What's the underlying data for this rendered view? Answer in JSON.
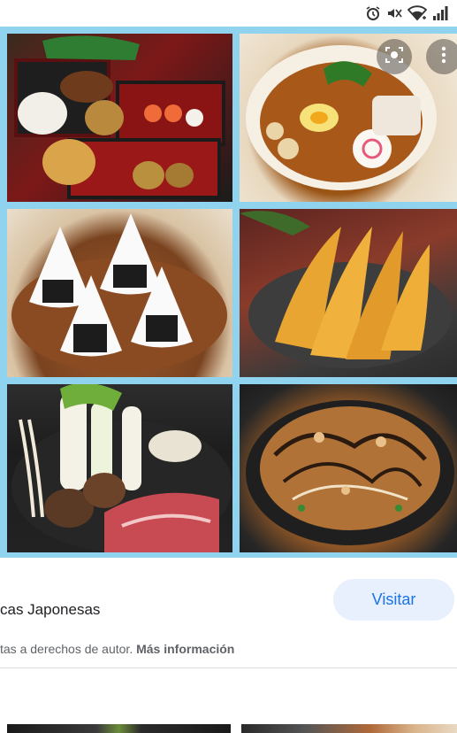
{
  "status_bar": {
    "icons": [
      "alarm-icon",
      "mute-icon",
      "wifi-icon",
      "signal-icon"
    ]
  },
  "image_overlay": {
    "lens_icon": "lens-icon",
    "more_icon": "more-vert-icon"
  },
  "result": {
    "title": "cas Japonesas",
    "visit_label": "Visitar",
    "notice_text": "tas a derechos de autor.",
    "notice_link": "Más información"
  }
}
